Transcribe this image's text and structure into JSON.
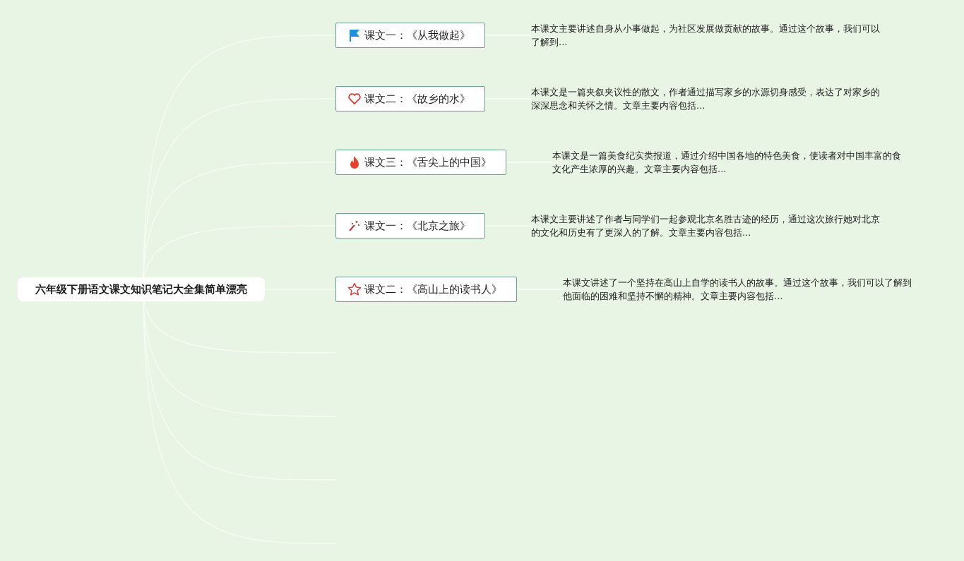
{
  "root": {
    "title": "六年级下册语文课文知识笔记大全集简单漂亮"
  },
  "topics": [
    {
      "kind": "flag",
      "title": "课文一：《从我做起》",
      "note": "本课文主要讲述自身从小事做起，为社区发展做贡献的故事。通过这个故事，我们可以了解到..."
    },
    {
      "kind": "heart",
      "title": "课文二：《故乡的水》",
      "note": "本课文是一篇夹叙夹议性的散文，作者通过描写家乡的水源切身感受，表达了对家乡的深深思念和关怀之情。文章主要内容包括..."
    },
    {
      "kind": "fire",
      "title": "课文三：《舌尖上的中国》",
      "note": "本课文是一篇美食纪实类报道，通过介绍中国各地的特色美食，使读者对中国丰富的食文化产生浓厚的兴趣。文章主要内容包括..."
    },
    {
      "kind": "wand",
      "title": "课文一：《北京之旅》",
      "note": "本课文主要讲述了作者与同学们一起参观北京名胜古迹的经历，通过这次旅行她对北京的文化和历史有了更深入的了解。文章主要内容包括..."
    },
    {
      "kind": "star",
      "title": "课文二：《高山上的读书人》",
      "note": "本课文讲述了一个坚持在高山上自学的读书人的故事。通过这个故事，我们可以了解到他面临的困难和坚持不懈的精神。文章主要内容包括..."
    }
  ]
}
